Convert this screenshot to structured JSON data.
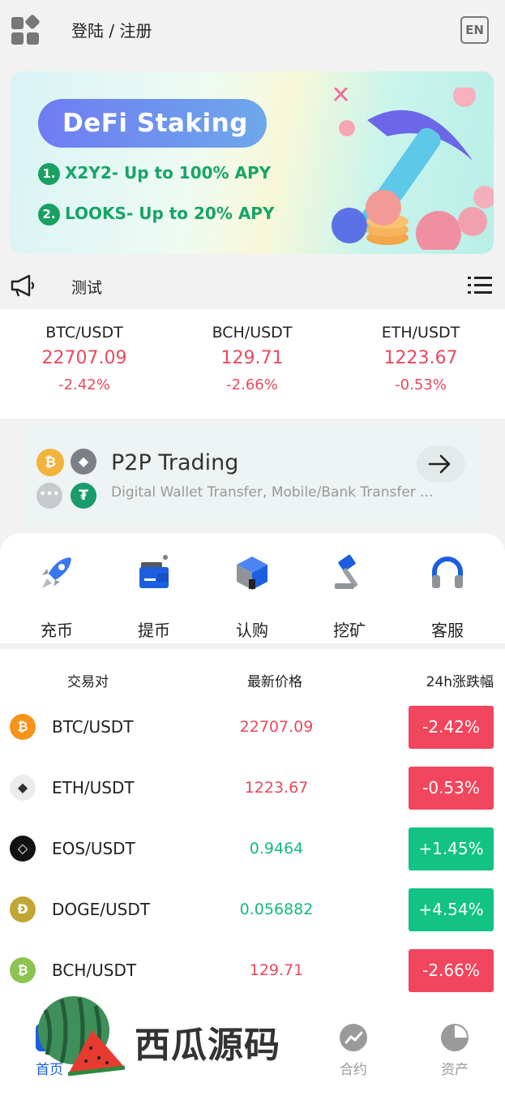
{
  "header": {
    "login_label": "登陆 / 注册",
    "lang_label": "EN"
  },
  "banner": {
    "title": "DeFi Staking",
    "items": [
      {
        "num": "1.",
        "text": "X2Y2- Up to 100% APY"
      },
      {
        "num": "2.",
        "text": "LOOKS- Up to 20% APY"
      }
    ]
  },
  "notice": {
    "text": "测试"
  },
  "tickers": [
    {
      "pair": "BTC/USDT",
      "price": "22707.09",
      "change": "-2.42%"
    },
    {
      "pair": "BCH/USDT",
      "price": "129.71",
      "change": "-2.66%"
    },
    {
      "pair": "ETH/USDT",
      "price": "1223.67",
      "change": "-0.53%"
    }
  ],
  "p2p": {
    "title": "P2P Trading",
    "subtitle": "Digital Wallet Transfer, Mobile/Bank Transfer ..."
  },
  "actions": [
    {
      "label": "充币",
      "icon": "rocket-icon"
    },
    {
      "label": "提币",
      "icon": "wallet-icon"
    },
    {
      "label": "认购",
      "icon": "cube-icon"
    },
    {
      "label": "挖矿",
      "icon": "hammer-icon"
    },
    {
      "label": "客服",
      "icon": "headset-icon"
    }
  ],
  "market": {
    "headers": {
      "pair": "交易对",
      "price": "最新价格",
      "change": "24h涨跌幅"
    },
    "rows": [
      {
        "pair": "BTC/USDT",
        "price": "22707.09",
        "change": "-2.42%",
        "trend": "down",
        "icon_color": "#f7931a",
        "icon_glyph": "₿"
      },
      {
        "pair": "ETH/USDT",
        "price": "1223.67",
        "change": "-0.53%",
        "trend": "down",
        "icon_color": "#ececec",
        "icon_glyph": "◆"
      },
      {
        "pair": "EOS/USDT",
        "price": "0.9464",
        "change": "+1.45%",
        "trend": "up",
        "icon_color": "#111111",
        "icon_glyph": "◇"
      },
      {
        "pair": "DOGE/USDT",
        "price": "0.056882",
        "change": "+4.54%",
        "trend": "up",
        "icon_color": "#c2a633",
        "icon_glyph": "Ð"
      },
      {
        "pair": "BCH/USDT",
        "price": "129.71",
        "change": "-2.66%",
        "trend": "down",
        "icon_color": "#8dc351",
        "icon_glyph": "₿"
      }
    ]
  },
  "bottom_nav": [
    {
      "label": "首页",
      "icon": "home-icon",
      "active": true
    },
    {
      "label": "合约",
      "icon": "chart-icon",
      "active": false
    },
    {
      "label": "资产",
      "icon": "pie-icon",
      "active": false
    }
  ],
  "watermark": {
    "text": "西瓜源码"
  },
  "colors": {
    "down": "#f2465e",
    "up": "#12c383",
    "accent": "#1b5fe0"
  }
}
